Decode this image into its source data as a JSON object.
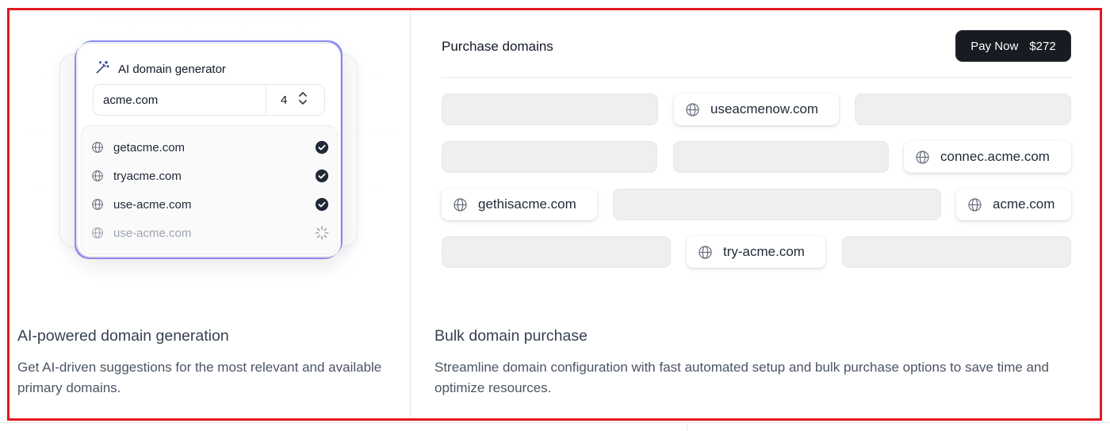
{
  "left_card": {
    "generator": {
      "title": "AI domain generator",
      "input_value": "acme.com",
      "count_value": "4",
      "results": [
        {
          "domain": "getacme.com",
          "status": "done"
        },
        {
          "domain": "tryacme.com",
          "status": "done"
        },
        {
          "domain": "use-acme.com",
          "status": "done"
        },
        {
          "domain": "use-acme.com",
          "status": "loading"
        }
      ]
    },
    "heading": "AI-powered domain generation",
    "description": "Get AI-driven suggestions for the most relevant and available primary domains."
  },
  "right_card": {
    "title": "Purchase domains",
    "pay_button": {
      "label": "Pay Now",
      "amount": "$272"
    },
    "domains": [
      "useacmenow.com",
      "connec.acme.com",
      "gethisacme.com",
      "acme.com",
      "try-acme.com"
    ],
    "heading": "Bulk domain purchase",
    "description": "Streamline domain configuration with fast automated setup and bulk purchase options to save time and optimize resources."
  },
  "colors": {
    "highlight_border": "#e0181f",
    "button_bg": "#181b21",
    "accent_glow": "#8b8cf6"
  },
  "icons": [
    "magic-wand-icon",
    "globe-icon",
    "check-circle-icon",
    "spinner-icon",
    "chevron-up-down-icon"
  ]
}
